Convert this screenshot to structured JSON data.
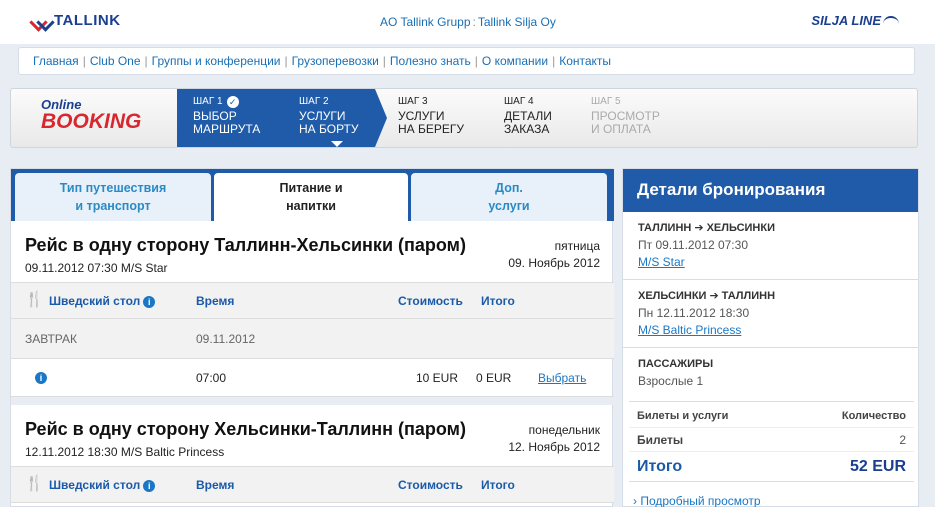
{
  "header": {
    "brand": "TALLINK",
    "company_left": "AO Tallink Grupp",
    "company_sep": ":",
    "company_right": "Tallink Silja Oy",
    "partner_brand": "SILJA LINE"
  },
  "nav": {
    "items": [
      "Главная",
      "Club One",
      "Группы и конференции",
      "Грузоперевозки",
      "Полезно знать",
      "О компании",
      "Контакты"
    ]
  },
  "booking_logo": {
    "line1": "Online",
    "line2": "BOOKING"
  },
  "steps": [
    {
      "num": "ШАГ 1",
      "title1": "ВЫБОР",
      "title2": "МАРШРУТА"
    },
    {
      "num": "ШАГ 2",
      "title1": "УСЛУГИ",
      "title2": "НА БОРТУ"
    },
    {
      "num": "ШАГ 3",
      "title1": "УСЛУГИ",
      "title2": "НА БЕРЕГУ"
    },
    {
      "num": "ШАГ 4",
      "title1": "ДЕТАЛИ",
      "title2": "ЗАКАЗА"
    },
    {
      "num": "ШАГ 5",
      "title1": "ПРОСМОТР",
      "title2": "И ОПЛАТА"
    }
  ],
  "tabs": [
    {
      "line1": "Тип путешествия",
      "line2": "и транспорт"
    },
    {
      "line1": "Питание и",
      "line2": "напитки"
    },
    {
      "line1": "Доп.",
      "line2": "услуги"
    }
  ],
  "journeys": [
    {
      "title": "Рейс в одну сторону Таллинн-Хельсинки (паром)",
      "subtitle": "09.11.2012 07:30 M/S Star",
      "day": "пятница",
      "date": "09. Ноябрь 2012",
      "columns": {
        "meal": "Шведский стол",
        "time": "Время",
        "price": "Стоимость",
        "total": "Итого"
      },
      "meal_name": "ЗАВТРАК",
      "meal_date": "09.11.2012",
      "time": "07:00",
      "price": "10 EUR",
      "total": "0 EUR",
      "select": "Выбрать"
    },
    {
      "title": "Рейс в одну сторону Хельсинки-Таллинн (паром)",
      "subtitle": "12.11.2012 18:30 M/S Baltic Princess",
      "day": "понедельник",
      "date": "12. Ноябрь 2012",
      "columns": {
        "meal": "Шведский стол",
        "time": "Время",
        "price": "Стоимость",
        "total": "Итого"
      }
    }
  ],
  "details": {
    "title": "Детали бронирования",
    "legs": [
      {
        "from": "ТАЛЛИНН",
        "to": "ХЕЛЬСИНКИ",
        "date": "Пт 09.11.2012 07:30",
        "ship": "M/S Star"
      },
      {
        "from": "ХЕЛЬСИНКИ",
        "to": "ТАЛЛИНН",
        "date": "Пн 12.11.2012 18:30",
        "ship": "M/S Baltic Princess"
      }
    ],
    "passengers_label": "ПАССАЖИРЫ",
    "passengers_value": "Взрослые 1",
    "summary": {
      "col_services": "Билеты и услуги",
      "col_qty": "Количество",
      "tickets_label": "Билеты",
      "tickets_qty": "2",
      "total_label": "Итого",
      "total_amount": "52 EUR"
    },
    "more_link": "Подробный просмотр"
  }
}
